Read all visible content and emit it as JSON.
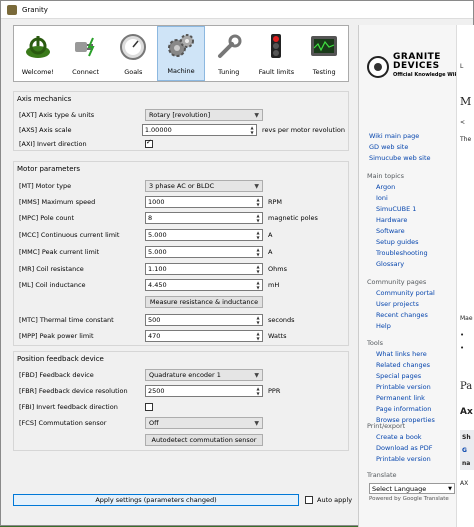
{
  "window": {
    "title": "Granity"
  },
  "toolbar": {
    "items": [
      {
        "label": "Welcome!",
        "icon": "power-icon"
      },
      {
        "label": "Connect",
        "icon": "plug-icon"
      },
      {
        "label": "Goals",
        "icon": "gauge-icon"
      },
      {
        "label": "Machine",
        "icon": "gears-icon",
        "active": true
      },
      {
        "label": "Tuning",
        "icon": "wrench-icon"
      },
      {
        "label": "Fault limits",
        "icon": "traffic-light-icon"
      },
      {
        "label": "Testing",
        "icon": "oscilloscope-icon"
      }
    ]
  },
  "axis": {
    "title": "Axis mechanics",
    "type_label": "[AXT] Axis type & units",
    "type_value": "Rotary [revolution]",
    "scale_label": "[AXS] Axis scale",
    "scale_value": "1.00000",
    "scale_unit": "revs per motor revolution",
    "invert_label": "[AXI] Invert direction",
    "invert_checked": true
  },
  "motor": {
    "title": "Motor parameters",
    "type_label": "[MT] Motor type",
    "type_value": "3 phase AC or BLDC",
    "mms_label": "[MMS] Maximum speed",
    "mms_value": "1000",
    "mms_unit": "RPM",
    "mpc_label": "[MPC] Pole count",
    "mpc_value": "8",
    "mpc_unit": "magnetic poles",
    "mcc_label": "[MCC] Continuous current limit",
    "mcc_value": "5.000",
    "mcc_unit": "A",
    "mmc_label": "[MMC] Peak current limit",
    "mmc_value": "5.000",
    "mmc_unit": "A",
    "mr_label": "[MR] Coil resistance",
    "mr_value": "1.100",
    "mr_unit": "Ohms",
    "ml_label": "[ML] Coil inductance",
    "ml_value": "4.450",
    "ml_unit": "mH",
    "measure_button": "Measure resistance & inductance",
    "mtc_label": "[MTC] Thermal time constant",
    "mtc_value": "500",
    "mtc_unit": "seconds",
    "mpp_label": "[MPP] Peak power limit",
    "mpp_value": "470",
    "mpp_unit": "Watts"
  },
  "feedback": {
    "title": "Position feedback device",
    "fbd_label": "[FBD] Feedback device",
    "fbd_value": "Quadrature encoder 1",
    "fbr_label": "[FBR] Feedback device resolution",
    "fbr_value": "2500",
    "fbr_unit": "PPR",
    "fbi_label": "[FBI] Invert feedback direction",
    "fbi_checked": false,
    "fcs_label": "[FCS] Commutation sensor",
    "fcs_value": "Off",
    "autodetect_button": "Autodetect commutation sensor"
  },
  "footer": {
    "apply_button": "Apply settings (parameters changed)",
    "auto_apply_label": "Auto apply"
  },
  "wiki": {
    "logo_line1": "GRANITE",
    "logo_line2": "DEVICES",
    "logo_line3": "Official Knowledge Wiki",
    "links_top": [
      "Wiki main page",
      "GD web site",
      "Simucube web site"
    ],
    "main_topics_header": "Main topics",
    "main_topics": [
      "Argon",
      "Ioni",
      "SimuCUBE 1",
      "Hardware",
      "Software",
      "Setup guides",
      "Troubleshooting",
      "Glossary"
    ],
    "community_header": "Community pages",
    "community": [
      "Community portal",
      "User projects",
      "Recent changes",
      "Help"
    ],
    "tools_header": "Tools",
    "tools": [
      "What links here",
      "Related changes",
      "Special pages",
      "Printable version",
      "Permanent link",
      "Page information",
      "Browse properties"
    ],
    "print_header": "Print/export",
    "print": [
      "Create a book",
      "Download as PDF",
      "Printable version"
    ],
    "translate_header": "Translate",
    "language_select": "Select Language",
    "powered_by": "Powered by Google Translate"
  },
  "strip": {
    "t1": "L",
    "t2": "M",
    "t3": "<",
    "t4": "The",
    "t5": "Mae",
    "t6": "•",
    "t7": "•",
    "t8": "Pa",
    "t9": "Ax",
    "t10": "Sh",
    "t11": "G",
    "t12": "na",
    "t13": "AX"
  },
  "colors": {
    "accent": "#0078d7",
    "link": "#0645ad",
    "active_tab": "#cfe4f7"
  }
}
